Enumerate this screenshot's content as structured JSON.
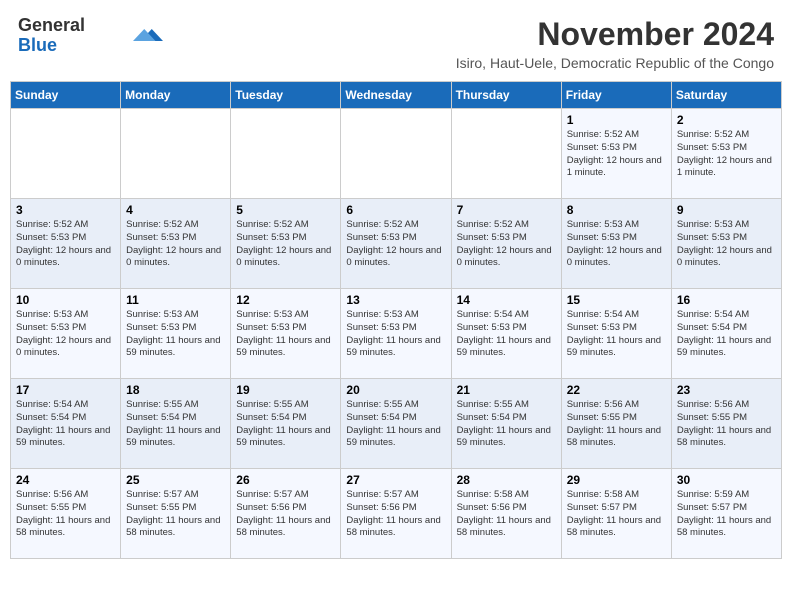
{
  "logo": {
    "text_general": "General",
    "text_blue": "Blue"
  },
  "header": {
    "month_title": "November 2024",
    "location": "Isiro, Haut-Uele, Democratic Republic of the Congo"
  },
  "weekdays": [
    "Sunday",
    "Monday",
    "Tuesday",
    "Wednesday",
    "Thursday",
    "Friday",
    "Saturday"
  ],
  "weeks": [
    [
      {
        "day": "",
        "info": ""
      },
      {
        "day": "",
        "info": ""
      },
      {
        "day": "",
        "info": ""
      },
      {
        "day": "",
        "info": ""
      },
      {
        "day": "",
        "info": ""
      },
      {
        "day": "1",
        "info": "Sunrise: 5:52 AM\nSunset: 5:53 PM\nDaylight: 12 hours and 1 minute."
      },
      {
        "day": "2",
        "info": "Sunrise: 5:52 AM\nSunset: 5:53 PM\nDaylight: 12 hours and 1 minute."
      }
    ],
    [
      {
        "day": "3",
        "info": "Sunrise: 5:52 AM\nSunset: 5:53 PM\nDaylight: 12 hours and 0 minutes."
      },
      {
        "day": "4",
        "info": "Sunrise: 5:52 AM\nSunset: 5:53 PM\nDaylight: 12 hours and 0 minutes."
      },
      {
        "day": "5",
        "info": "Sunrise: 5:52 AM\nSunset: 5:53 PM\nDaylight: 12 hours and 0 minutes."
      },
      {
        "day": "6",
        "info": "Sunrise: 5:52 AM\nSunset: 5:53 PM\nDaylight: 12 hours and 0 minutes."
      },
      {
        "day": "7",
        "info": "Sunrise: 5:52 AM\nSunset: 5:53 PM\nDaylight: 12 hours and 0 minutes."
      },
      {
        "day": "8",
        "info": "Sunrise: 5:53 AM\nSunset: 5:53 PM\nDaylight: 12 hours and 0 minutes."
      },
      {
        "day": "9",
        "info": "Sunrise: 5:53 AM\nSunset: 5:53 PM\nDaylight: 12 hours and 0 minutes."
      }
    ],
    [
      {
        "day": "10",
        "info": "Sunrise: 5:53 AM\nSunset: 5:53 PM\nDaylight: 12 hours and 0 minutes."
      },
      {
        "day": "11",
        "info": "Sunrise: 5:53 AM\nSunset: 5:53 PM\nDaylight: 11 hours and 59 minutes."
      },
      {
        "day": "12",
        "info": "Sunrise: 5:53 AM\nSunset: 5:53 PM\nDaylight: 11 hours and 59 minutes."
      },
      {
        "day": "13",
        "info": "Sunrise: 5:53 AM\nSunset: 5:53 PM\nDaylight: 11 hours and 59 minutes."
      },
      {
        "day": "14",
        "info": "Sunrise: 5:54 AM\nSunset: 5:53 PM\nDaylight: 11 hours and 59 minutes."
      },
      {
        "day": "15",
        "info": "Sunrise: 5:54 AM\nSunset: 5:53 PM\nDaylight: 11 hours and 59 minutes."
      },
      {
        "day": "16",
        "info": "Sunrise: 5:54 AM\nSunset: 5:54 PM\nDaylight: 11 hours and 59 minutes."
      }
    ],
    [
      {
        "day": "17",
        "info": "Sunrise: 5:54 AM\nSunset: 5:54 PM\nDaylight: 11 hours and 59 minutes."
      },
      {
        "day": "18",
        "info": "Sunrise: 5:55 AM\nSunset: 5:54 PM\nDaylight: 11 hours and 59 minutes."
      },
      {
        "day": "19",
        "info": "Sunrise: 5:55 AM\nSunset: 5:54 PM\nDaylight: 11 hours and 59 minutes."
      },
      {
        "day": "20",
        "info": "Sunrise: 5:55 AM\nSunset: 5:54 PM\nDaylight: 11 hours and 59 minutes."
      },
      {
        "day": "21",
        "info": "Sunrise: 5:55 AM\nSunset: 5:54 PM\nDaylight: 11 hours and 59 minutes."
      },
      {
        "day": "22",
        "info": "Sunrise: 5:56 AM\nSunset: 5:55 PM\nDaylight: 11 hours and 58 minutes."
      },
      {
        "day": "23",
        "info": "Sunrise: 5:56 AM\nSunset: 5:55 PM\nDaylight: 11 hours and 58 minutes."
      }
    ],
    [
      {
        "day": "24",
        "info": "Sunrise: 5:56 AM\nSunset: 5:55 PM\nDaylight: 11 hours and 58 minutes."
      },
      {
        "day": "25",
        "info": "Sunrise: 5:57 AM\nSunset: 5:55 PM\nDaylight: 11 hours and 58 minutes."
      },
      {
        "day": "26",
        "info": "Sunrise: 5:57 AM\nSunset: 5:56 PM\nDaylight: 11 hours and 58 minutes."
      },
      {
        "day": "27",
        "info": "Sunrise: 5:57 AM\nSunset: 5:56 PM\nDaylight: 11 hours and 58 minutes."
      },
      {
        "day": "28",
        "info": "Sunrise: 5:58 AM\nSunset: 5:56 PM\nDaylight: 11 hours and 58 minutes."
      },
      {
        "day": "29",
        "info": "Sunrise: 5:58 AM\nSunset: 5:57 PM\nDaylight: 11 hours and 58 minutes."
      },
      {
        "day": "30",
        "info": "Sunrise: 5:59 AM\nSunset: 5:57 PM\nDaylight: 11 hours and 58 minutes."
      }
    ]
  ]
}
